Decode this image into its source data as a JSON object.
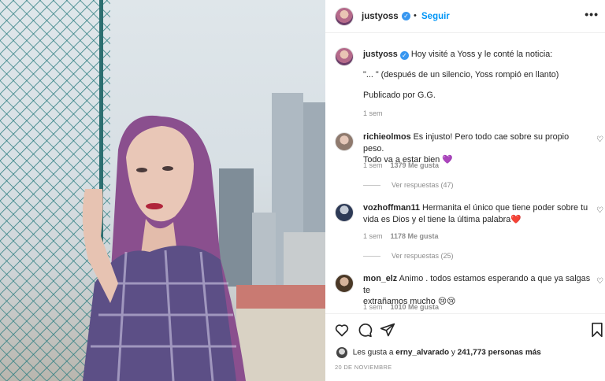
{
  "post": {
    "username": "justyoss",
    "follow_label": "Seguir",
    "separator": "•",
    "more_label": "•••"
  },
  "caption": {
    "username": "justyoss",
    "line1": "Hoy visité a Yoss y le conté la noticia:",
    "line2": "\"... \" (después de un silencio, Yoss rompió en llanto)",
    "line3": "Publicado por G.G.",
    "time": "1 sem"
  },
  "comments": [
    {
      "username": "richieolmos",
      "text_line1": "Es injusto! Pero todo cae sobre su propio peso.",
      "text_line2": "Todo va a estar bien 💜",
      "time": "1 sem",
      "likes": "1379 Me gusta",
      "replies": "Ver respuestas (47)"
    },
    {
      "username": "vozhoffman11",
      "text_line1": "Hermanita el único que tiene poder sobre tu",
      "text_line2": "vida es Dios y el tiene la última palabra❤️",
      "time": "1 sem",
      "likes": "1178 Me gusta",
      "replies": "Ver respuestas (25)"
    },
    {
      "username": "mon_elz",
      "text_line1": "Animo . todos estamos esperando a que ya salgas te",
      "text_line2": "extrañamos mucho 😢😢",
      "time": "1 sem",
      "likes": "1010 Me gusta"
    }
  ],
  "likes_summary": {
    "prefix": "Les gusta a",
    "user": "erny_alvarado",
    "middle": "y",
    "count": "241,773 personas más"
  },
  "date": "20 DE NOVIEMBRE",
  "icons": {
    "like": "heart-icon",
    "comment": "comment-icon",
    "share": "share-icon",
    "save": "bookmark-icon",
    "more": "more-options-icon",
    "verified": "verified-badge-icon"
  },
  "colors": {
    "link": "#0095f6",
    "verified": "#3897f0",
    "text": "#262626",
    "muted": "#8e8e8e",
    "fence": "#2f7f82"
  }
}
